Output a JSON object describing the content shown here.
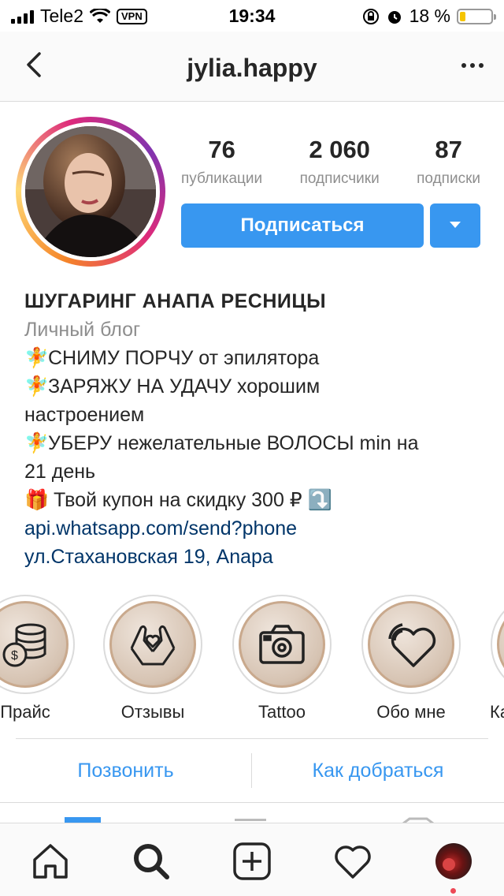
{
  "status": {
    "carrier": "Tele2",
    "vpn": "VPN",
    "time": "19:34",
    "battery": "18 %",
    "battery_level": 0.18
  },
  "nav": {
    "title": "jylia.happy"
  },
  "profile": {
    "stats": [
      {
        "value": "76",
        "label": "публикации"
      },
      {
        "value": "2 060",
        "label": "подписчики"
      },
      {
        "value": "87",
        "label": "подписки"
      }
    ],
    "follow_label": "Подписаться"
  },
  "bio": {
    "name": "ШУГАРИНГ АНАПА РЕСНИЦЫ",
    "category": "Личный блог",
    "lines": [
      {
        "emoji": "🧚",
        "text": "СНИМУ ПОРЧУ от эпилятора"
      },
      {
        "emoji": "🧚",
        "text": "ЗАРЯЖУ НА УДАЧУ хорошим"
      },
      {
        "emoji": "",
        "text": "настроением"
      },
      {
        "emoji": "🧚",
        "text": "УБЕРУ нежелательные ВОЛОСЫ min на"
      },
      {
        "emoji": "",
        "text": "21 день"
      },
      {
        "emoji": "🎁",
        "text": " Твой купон на скидку 300 ₽ ⤵️"
      }
    ],
    "link": "api.whatsapp.com/send?phone",
    "address": "ул.Стахановская 19, Anapa"
  },
  "highlights": [
    {
      "label": "Прайс",
      "icon": "coins-icon"
    },
    {
      "label": "Отзывы",
      "icon": "heart-hands-icon"
    },
    {
      "label": "Tattoo",
      "icon": "camera-icon"
    },
    {
      "label": "Обо мне",
      "icon": "heart-wifi-icon"
    },
    {
      "label": "Ка",
      "icon": "partial-icon"
    }
  ],
  "contact": {
    "call_label": "Позвонить",
    "directions_label": "Как добраться"
  },
  "colors": {
    "accent": "#3897f0",
    "link": "#003569",
    "notification": "#ed4956"
  }
}
